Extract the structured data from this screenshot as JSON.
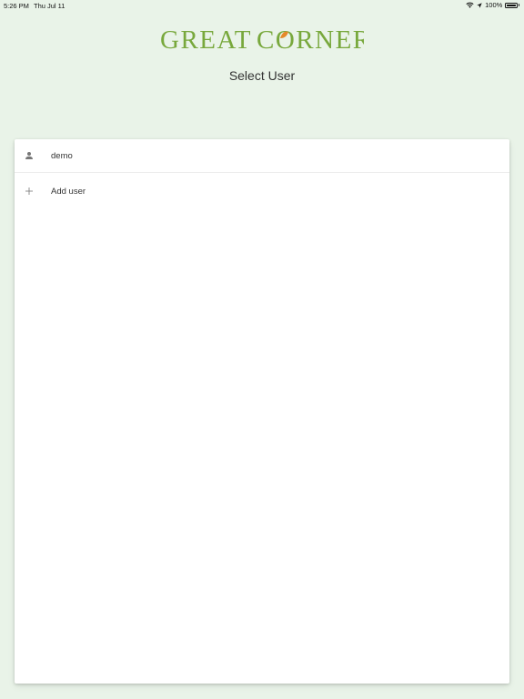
{
  "status_bar": {
    "time": "5:26 PM",
    "date": "Thu Jul 11",
    "battery": "100%"
  },
  "logo": {
    "text": "GREAT CORNER",
    "brand_color": "#78a83c",
    "accent_color": "#e6892a"
  },
  "page": {
    "title": "Select User"
  },
  "users": [
    {
      "name": "demo",
      "icon": "person-icon"
    }
  ],
  "add_user": {
    "label": "Add user",
    "icon": "plus-icon"
  }
}
